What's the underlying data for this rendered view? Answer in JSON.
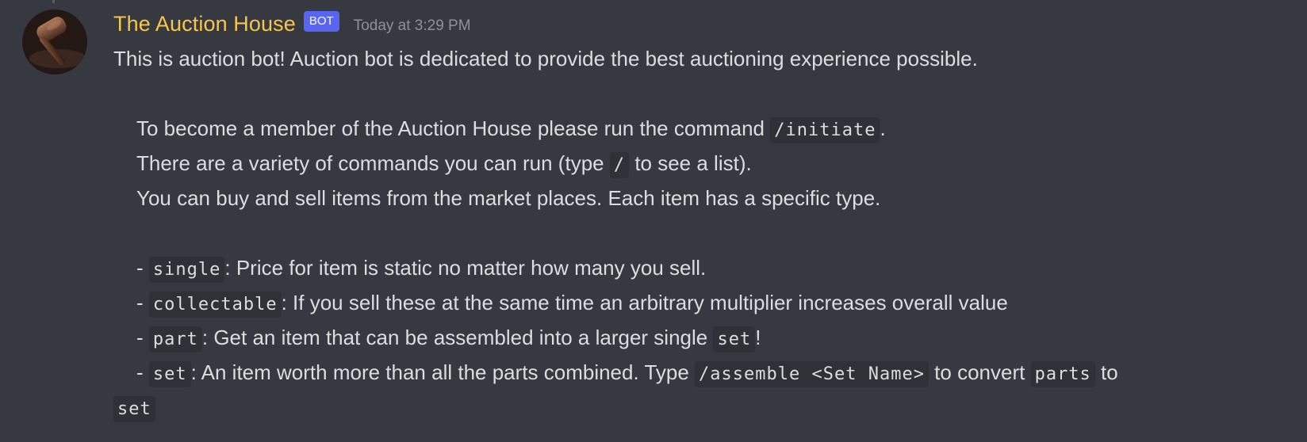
{
  "message": {
    "author": "The Auction House",
    "bot_tag": "BOT",
    "timestamp": "Today at 3:29 PM",
    "intro": "This is auction bot! Auction bot is dedicated to provide the best auctioning experience possible.",
    "p1_a": "To become a member of the Auction House please run the command ",
    "p1_code": "/initiate",
    "p1_b": ".",
    "p2_a": "There are a variety of commands you can run (type ",
    "p2_code": "/",
    "p2_b": " to see a list).",
    "p3": "You can buy and sell items from the market places. Each item has a specific type.",
    "items": [
      {
        "dash": "- ",
        "code": "single",
        "text": ": Price for item is static no matter how many you sell."
      },
      {
        "dash": "- ",
        "code": "collectable",
        "text": ": If you sell these at the same time an arbitrary multiplier increases overall value"
      },
      {
        "dash": "- ",
        "code": "part",
        "text": ": Get an item that can be assembled into a larger single ",
        "code2": "set",
        "text2": "!"
      },
      {
        "dash": "- ",
        "code": "set",
        "text": ": An item worth more than all the parts combined. Type ",
        "code2": "/assemble <Set Name>",
        "text2": " to convert ",
        "code3": "parts",
        "text3": " to"
      }
    ],
    "wrap_code": "set"
  },
  "icons": {
    "avatar": "gavel-avatar-icon"
  }
}
